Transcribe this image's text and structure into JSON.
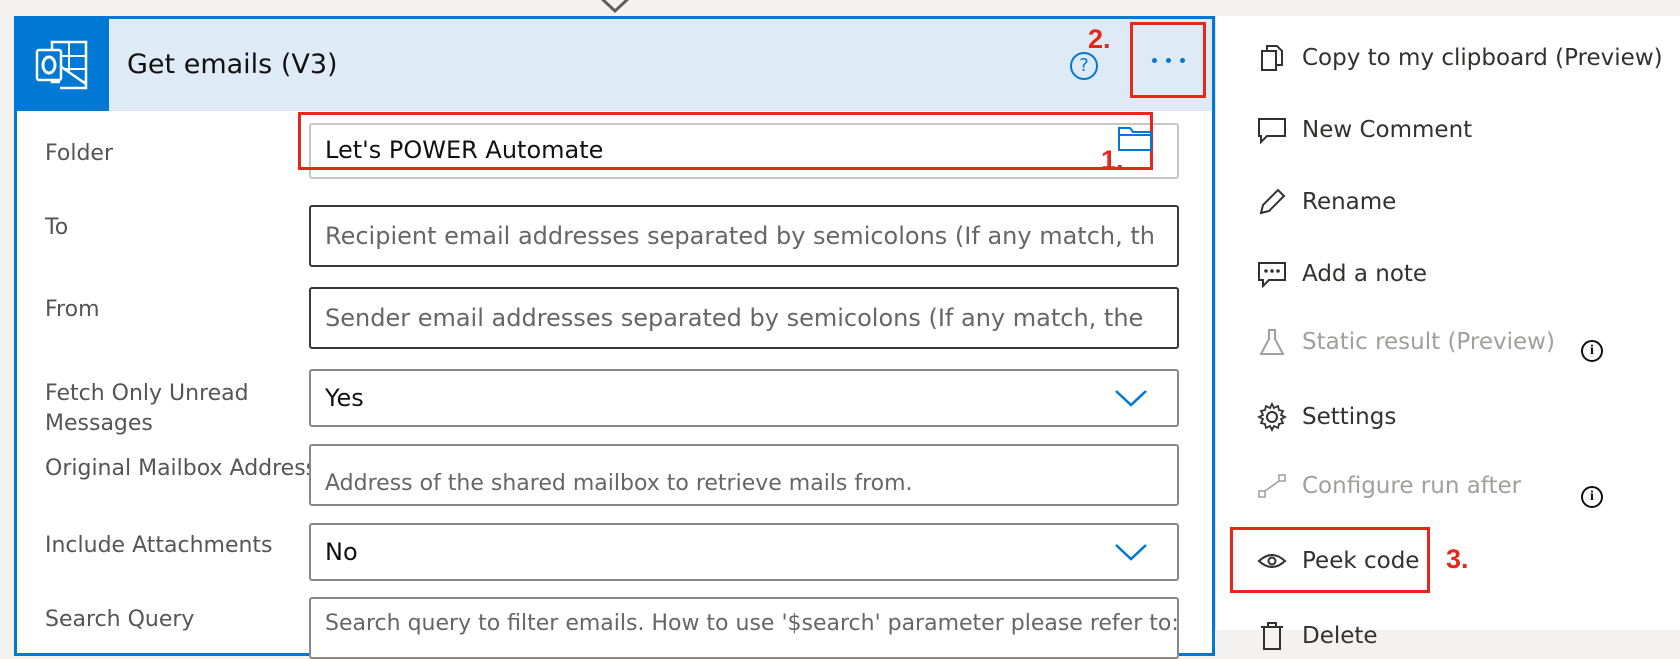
{
  "action": {
    "title": "Get emails (V3)",
    "help_glyph": "?",
    "more_label": "...",
    "fields": {
      "folder": {
        "label": "Folder",
        "value": "Let's POWER Automate"
      },
      "to": {
        "label": "To",
        "placeholder": "Recipient email addresses separated by semicolons (If any match, th"
      },
      "from": {
        "label": "From",
        "placeholder": "Sender email addresses separated by semicolons (If any match, the"
      },
      "unread": {
        "label_line1": "Fetch Only Unread",
        "label_line2": "Messages",
        "value": "Yes"
      },
      "mailbox": {
        "label": "Original Mailbox Address",
        "placeholder": "Address of the shared mailbox to retrieve mails from."
      },
      "attachments": {
        "label": "Include Attachments",
        "value": "No"
      },
      "search": {
        "label": "Search Query",
        "placeholder": "Search query to filter emails. How to use '$search' parameter please refer to: h"
      }
    }
  },
  "annotations": {
    "step1": "1.",
    "step2": "2.",
    "step3": "3."
  },
  "menu": {
    "items": [
      {
        "label": "Copy to my clipboard (Preview)",
        "icon": "copy-icon",
        "enabled": true
      },
      {
        "label": "New Comment",
        "icon": "comment-icon",
        "enabled": true
      },
      {
        "label": "Rename",
        "icon": "pencil-icon",
        "enabled": true
      },
      {
        "label": "Add a note",
        "icon": "note-icon",
        "enabled": true
      },
      {
        "label": "Static result (Preview)",
        "icon": "flask-icon",
        "enabled": false
      },
      {
        "label": "Settings",
        "icon": "gear-icon",
        "enabled": true
      },
      {
        "label": "Configure run after",
        "icon": "run-after-icon",
        "enabled": false
      },
      {
        "label": "Peek code",
        "icon": "eye-icon",
        "enabled": true
      },
      {
        "label": "Delete",
        "icon": "trash-icon",
        "enabled": true
      }
    ],
    "info_glyph": "i"
  },
  "colors": {
    "accent": "#0078d4",
    "annotation": "#e8271b",
    "header_bg": "#deebf7"
  }
}
